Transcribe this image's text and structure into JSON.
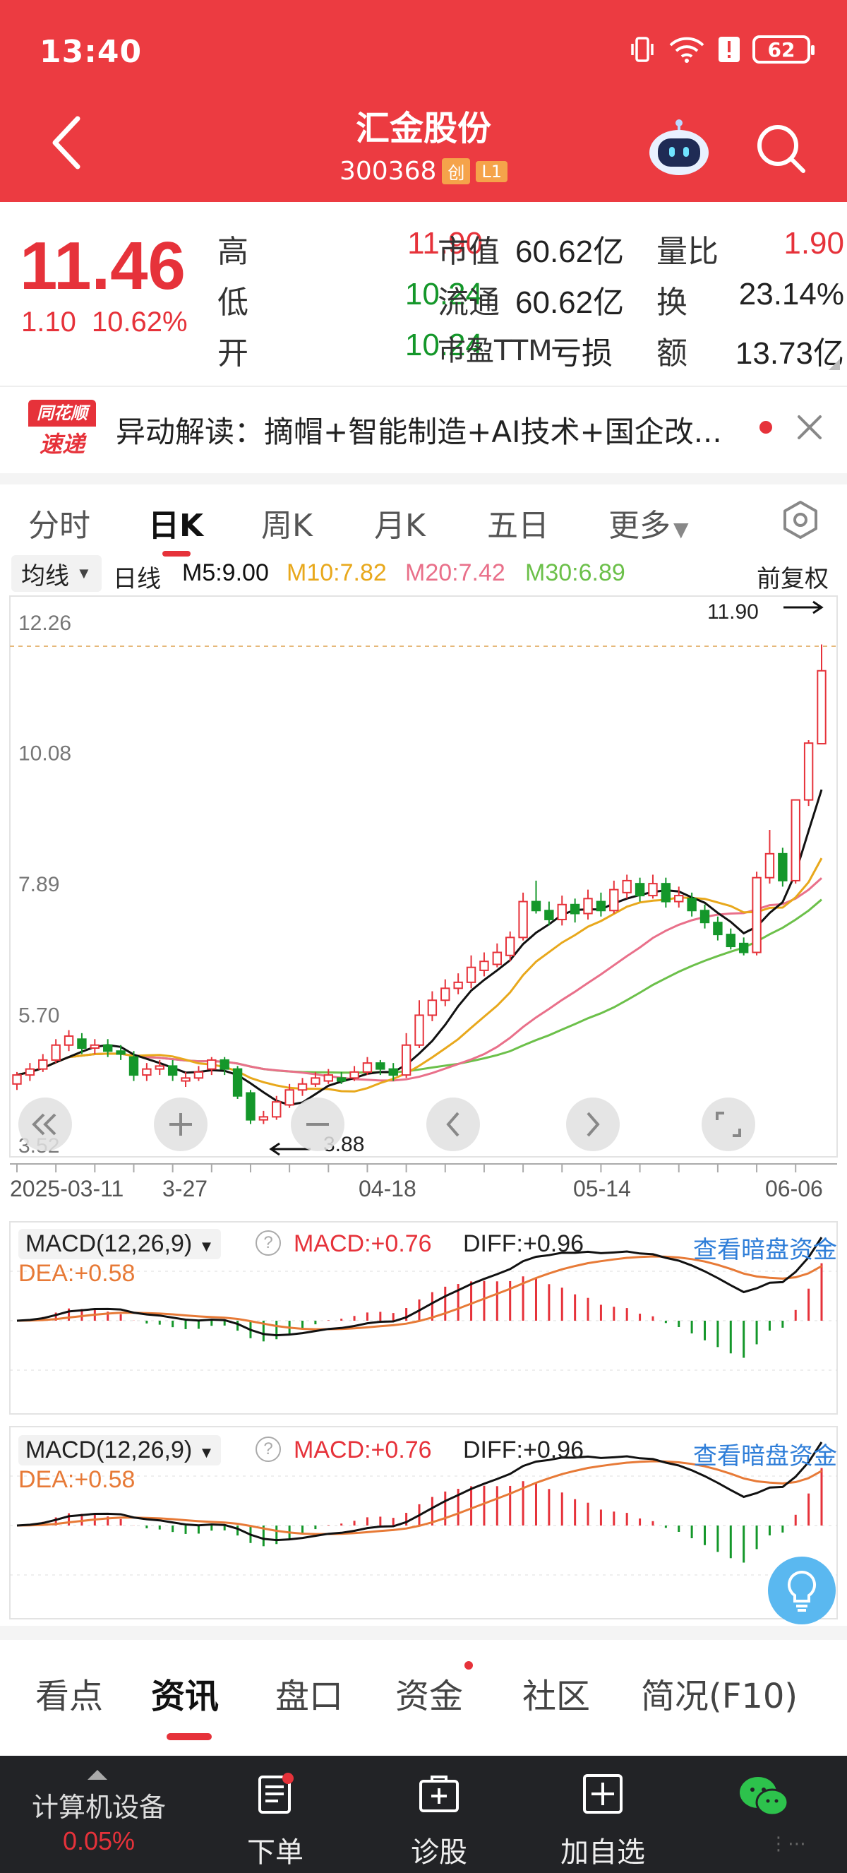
{
  "status": {
    "time": "13:40",
    "battery": "62"
  },
  "header": {
    "name": "汇金股份",
    "code": "300368",
    "tag1": "创",
    "tag2": "L1"
  },
  "quote": {
    "price": "11.46",
    "change": "1.10",
    "change_pct": "10.62%",
    "rows": [
      {
        "l1": "高",
        "v1": "11.90",
        "l2": "市值",
        "v2": "60.62亿",
        "l3": "量比",
        "v3": "1.90"
      },
      {
        "l1": "低",
        "v1": "10.24",
        "l2": "流通",
        "v2": "60.62亿",
        "l3": "换",
        "v3": "23.14%"
      },
      {
        "l1": "开",
        "v1": "10.24",
        "l2": "市盈TTM",
        "v2": "亏损",
        "l3": "额",
        "v3": "13.73亿"
      }
    ]
  },
  "news": {
    "logo_top": "同花顺",
    "logo_bottom": "速递",
    "text": "异动解读：摘帽+智能制造+AI技术+国企改..."
  },
  "period_tabs": [
    "分时",
    "日K",
    "周K",
    "月K",
    "五日",
    "更多"
  ],
  "chart_header": {
    "ma_select": "均线",
    "line_type": "日线",
    "m5": "M5:9.00",
    "m10": "M10:7.82",
    "m20": "M20:7.42",
    "m30": "M30:6.89",
    "adjust": "前复权"
  },
  "macd_panels": [
    {
      "title": "MACD(12,26,9)",
      "macd": "MACD:+0.76",
      "diff": "DIFF:+0.96",
      "dea": "DEA:+0.58",
      "link": "查看暗盘资金"
    },
    {
      "title": "MACD(12,26,9)",
      "macd": "MACD:+0.76",
      "diff": "DIFF:+0.96",
      "dea": "DEA:+0.58",
      "link": "查看暗盘资金"
    }
  ],
  "bottom_tabs": [
    "看点",
    "资讯",
    "盘口",
    "资金",
    "社区",
    "简况(F10)"
  ],
  "bottom_nav": {
    "sector": "计算机设备",
    "sector_pct": "0.05%",
    "buttons": [
      "下单",
      "诊股",
      "加自选"
    ]
  },
  "colors": {
    "brand_red": "#ec3b41",
    "up": "#e6323a",
    "down": "#14972a",
    "ma5": "#111111",
    "ma10": "#e8a81c",
    "ma20": "#e9708a",
    "ma30": "#6cc04a"
  },
  "chart_data": {
    "type": "candlestick",
    "y_ticks": [
      "12.26",
      "10.08",
      "7.89",
      "5.70",
      "3.52"
    ],
    "ylim": [
      3.52,
      12.26
    ],
    "x_ticks": [
      "2025-03-11",
      "3-27",
      "04-18",
      "05-14",
      "06-06"
    ],
    "high_label": "11.90",
    "low_label": "3.88",
    "candles": [
      [
        4.55,
        4.7,
        4.75,
        4.45
      ],
      [
        4.7,
        4.8,
        4.9,
        4.6
      ],
      [
        4.8,
        4.95,
        5.05,
        4.75
      ],
      [
        4.95,
        5.2,
        5.3,
        4.9
      ],
      [
        5.2,
        5.35,
        5.45,
        5.1
      ],
      [
        5.3,
        5.15,
        5.4,
        5.05
      ],
      [
        5.15,
        5.2,
        5.3,
        5.05
      ],
      [
        5.2,
        5.1,
        5.3,
        5.0
      ],
      [
        5.1,
        5.05,
        5.2,
        4.95
      ],
      [
        5.0,
        4.7,
        5.1,
        4.6
      ],
      [
        4.7,
        4.8,
        4.9,
        4.6
      ],
      [
        4.8,
        4.85,
        4.95,
        4.7
      ],
      [
        4.85,
        4.7,
        4.95,
        4.6
      ],
      [
        4.6,
        4.65,
        4.75,
        4.5
      ],
      [
        4.65,
        4.75,
        4.85,
        4.6
      ],
      [
        4.8,
        4.95,
        5.0,
        4.7
      ],
      [
        4.95,
        4.8,
        5.0,
        4.7
      ],
      [
        4.8,
        4.35,
        4.85,
        4.3
      ],
      [
        4.4,
        3.95,
        4.45,
        3.88
      ],
      [
        3.95,
        4.0,
        4.1,
        3.88
      ],
      [
        4.0,
        4.25,
        4.35,
        3.95
      ],
      [
        4.2,
        4.45,
        4.55,
        4.15
      ],
      [
        4.45,
        4.55,
        4.65,
        4.35
      ],
      [
        4.55,
        4.65,
        4.75,
        4.5
      ],
      [
        4.6,
        4.7,
        4.8,
        4.55
      ],
      [
        4.65,
        4.6,
        4.75,
        4.55
      ],
      [
        4.65,
        4.75,
        4.85,
        4.6
      ],
      [
        4.75,
        4.9,
        5.0,
        4.7
      ],
      [
        4.9,
        4.8,
        4.95,
        4.7
      ],
      [
        4.8,
        4.7,
        4.9,
        4.6
      ],
      [
        4.7,
        5.2,
        5.4,
        4.65
      ],
      [
        5.2,
        5.7,
        5.95,
        5.15
      ],
      [
        5.7,
        5.95,
        6.1,
        5.6
      ],
      [
        5.95,
        6.15,
        6.3,
        5.85
      ],
      [
        6.15,
        6.25,
        6.4,
        6.05
      ],
      [
        6.25,
        6.5,
        6.7,
        6.15
      ],
      [
        6.45,
        6.6,
        6.75,
        6.35
      ],
      [
        6.55,
        6.75,
        6.9,
        6.5
      ],
      [
        6.7,
        7.0,
        7.1,
        6.6
      ],
      [
        7.0,
        7.6,
        7.75,
        6.95
      ],
      [
        7.6,
        7.45,
        7.95,
        7.4
      ],
      [
        7.45,
        7.3,
        7.6,
        7.2
      ],
      [
        7.3,
        7.55,
        7.7,
        7.2
      ],
      [
        7.55,
        7.4,
        7.65,
        7.25
      ],
      [
        7.4,
        7.65,
        7.8,
        7.3
      ],
      [
        7.6,
        7.45,
        7.75,
        7.35
      ],
      [
        7.45,
        7.8,
        7.95,
        7.4
      ],
      [
        7.75,
        7.95,
        8.05,
        7.65
      ],
      [
        7.9,
        7.7,
        8.0,
        7.6
      ],
      [
        7.7,
        7.9,
        8.05,
        7.65
      ],
      [
        7.9,
        7.6,
        8.0,
        7.5
      ],
      [
        7.6,
        7.7,
        7.85,
        7.5
      ],
      [
        7.65,
        7.45,
        7.75,
        7.35
      ],
      [
        7.45,
        7.25,
        7.55,
        7.15
      ],
      [
        7.25,
        7.05,
        7.35,
        6.95
      ],
      [
        7.05,
        6.85,
        7.15,
        6.8
      ],
      [
        6.9,
        6.75,
        7.0,
        6.7
      ],
      [
        6.75,
        8.0,
        8.1,
        6.7
      ],
      [
        8.0,
        8.4,
        8.8,
        7.9
      ],
      [
        8.4,
        7.95,
        8.5,
        7.85
      ],
      [
        7.95,
        9.3,
        9.3,
        7.9
      ],
      [
        9.3,
        10.25,
        10.3,
        9.2
      ],
      [
        10.24,
        11.46,
        11.9,
        10.24
      ]
    ]
  }
}
